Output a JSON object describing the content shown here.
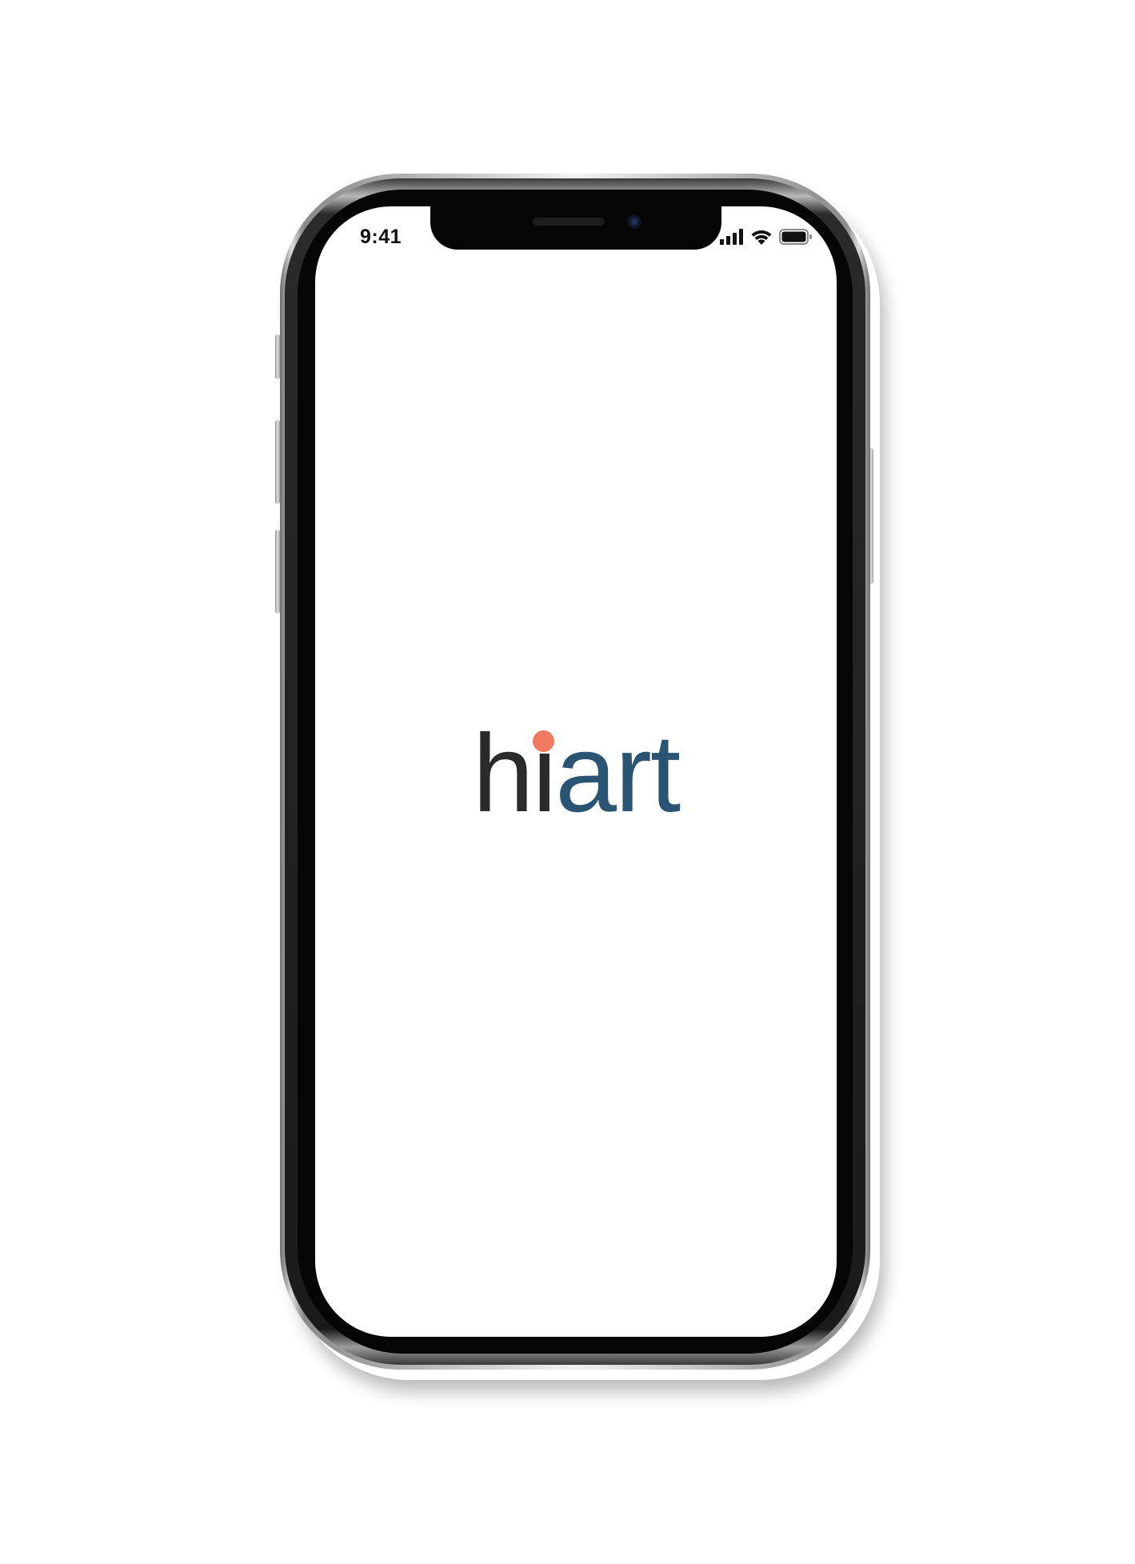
{
  "status_bar": {
    "time": "9:41",
    "signal_icon": "cellular-signal-icon",
    "wifi_icon": "wifi-icon",
    "battery_icon": "battery-icon"
  },
  "logo": {
    "part_dark": "hi",
    "part_blue": "art",
    "colors": {
      "dark": "#2a2a2a",
      "blue": "#2b5472",
      "dot": "#ef7a60"
    }
  }
}
